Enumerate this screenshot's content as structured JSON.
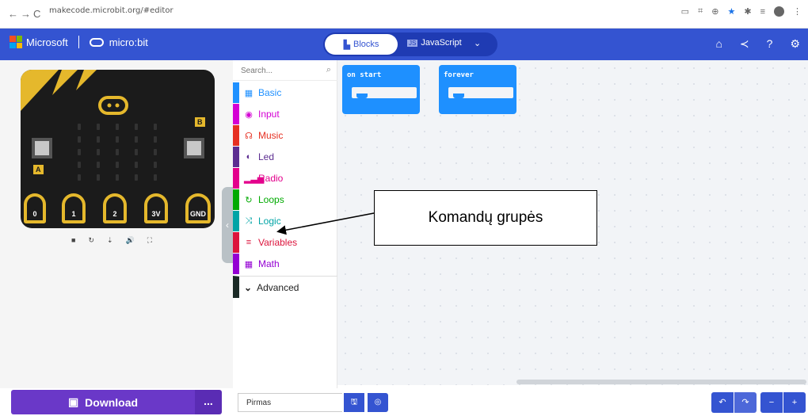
{
  "browser": {
    "url": "makecode.microbit.org/#editor",
    "nav": [
      "←",
      "→",
      "C",
      "🔒"
    ],
    "tray": [
      "▭",
      "⌗",
      "⊕",
      "★",
      "✱",
      "≡"
    ]
  },
  "header": {
    "brand": "Microsoft",
    "product": "micro:bit",
    "blocks_tab": "Blocks",
    "blocks_icon": "puzzle",
    "js_tab": "JavaScript",
    "dropdown": "⌄",
    "icons": [
      "home-icon",
      "share-icon",
      "help-icon",
      "settings-icon"
    ],
    "icon_glyphs": [
      "⌂",
      "≺",
      "?",
      "⚙"
    ]
  },
  "simulator": {
    "button_a": "A",
    "button_b": "B",
    "pins": [
      "0",
      "1",
      "2",
      "3V",
      "GND"
    ],
    "controls": [
      "■",
      "↻",
      "⇣",
      "🔊",
      "⛶"
    ],
    "collapse": "‹"
  },
  "toolbox": {
    "search_placeholder": "Search...",
    "search_icon": "⌕",
    "categories": [
      {
        "label": "Basic",
        "icon": "▦",
        "color": "#1e90ff"
      },
      {
        "label": "Input",
        "icon": "◉",
        "color": "#d400d4"
      },
      {
        "label": "Music",
        "icon": "☊",
        "color": "#e63022"
      },
      {
        "label": "Led",
        "icon": "◐",
        "color": "#5c2d91"
      },
      {
        "label": "Radio",
        "icon": "▂▃▅",
        "color": "#e3008c"
      },
      {
        "label": "Loops",
        "icon": "↻",
        "color": "#00aa00"
      },
      {
        "label": "Logic",
        "icon": "⤨",
        "color": "#00a4a6"
      },
      {
        "label": "Variables",
        "icon": "≡",
        "color": "#dc143c"
      },
      {
        "label": "Math",
        "icon": "▦",
        "color": "#9400d3"
      }
    ],
    "advanced": "Advanced",
    "advanced_icon": "⌄"
  },
  "workspace": {
    "blocks": [
      "on start",
      "forever"
    ],
    "block_color": "#1e90ff"
  },
  "annotation": {
    "label": "Komandų grupės"
  },
  "bottom": {
    "download": "Download",
    "download_icon": "▣",
    "more": "...",
    "project_name": "Pirmas",
    "save_icon": "🖫",
    "github_icon": "◎",
    "undo": "↶",
    "redo": "↷",
    "zoom_out": "−",
    "zoom_in": "+"
  },
  "colors": {
    "accent": "#3454d1",
    "download": "#6a38c8",
    "board_gold": "#e5b82c"
  }
}
